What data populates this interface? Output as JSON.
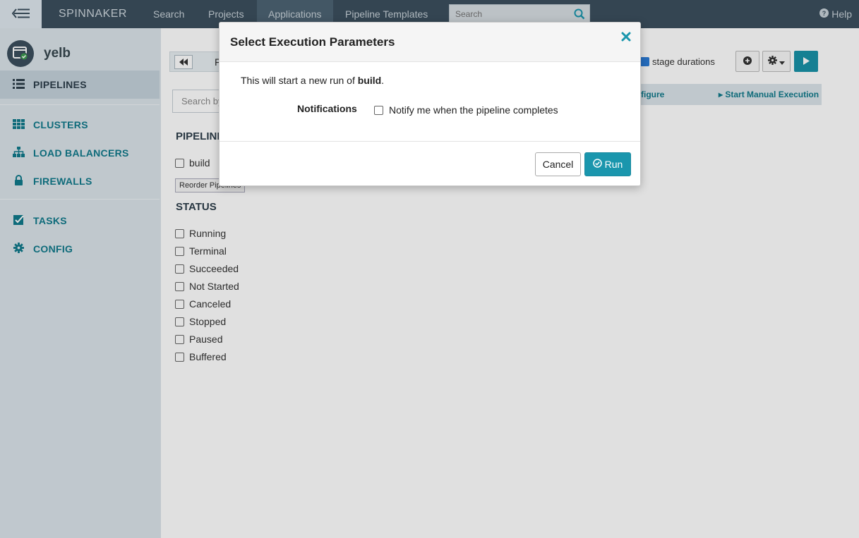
{
  "nav": {
    "brand": "SPINNAKER",
    "links": [
      {
        "label": "Search"
      },
      {
        "label": "Projects"
      },
      {
        "label": "Applications"
      },
      {
        "label": "Pipeline Templates"
      }
    ],
    "search_placeholder": "Search",
    "help_label": "Help"
  },
  "sidebar": {
    "app_name": "yelb",
    "items": [
      {
        "label": "PIPELINES",
        "icon": "list-icon"
      },
      {
        "label": "CLUSTERS",
        "icon": "grid-icon"
      },
      {
        "label": "LOAD BALANCERS",
        "icon": "sitemap-icon"
      },
      {
        "label": "FIREWALLS",
        "icon": "lock-icon"
      },
      {
        "label": "TASKS",
        "icon": "checkbox-icon"
      },
      {
        "label": "CONFIG",
        "icon": "gear-icon"
      }
    ]
  },
  "main": {
    "toolbar_partial": "F",
    "search_placeholder": "Search by",
    "pipelines_title": "PIPELINE",
    "pipelines": [
      {
        "label": "build"
      }
    ],
    "reorder_label": "Reorder Pipelines",
    "status_title": "STATUS",
    "statuses": [
      {
        "label": "Running"
      },
      {
        "label": "Terminal"
      },
      {
        "label": "Succeeded"
      },
      {
        "label": "Not Started"
      },
      {
        "label": "Canceled"
      },
      {
        "label": "Stopped"
      },
      {
        "label": "Paused"
      },
      {
        "label": "Buffered"
      }
    ],
    "stage_durations_label": "stage durations",
    "configure_label": "figure",
    "start_manual_label": "Start Manual Execution"
  },
  "modal": {
    "title": "Select Execution Parameters",
    "message_prefix": "This will start a new run of ",
    "pipeline_name": "build",
    "message_suffix": ".",
    "notifications_label": "Notifications",
    "notify_option": "Notify me when the pipeline completes",
    "cancel_label": "Cancel",
    "run_label": "Run"
  },
  "colors": {
    "accent": "#1a96ad",
    "nav_bg": "#3c4f5e",
    "sidebar_bg": "#dbe4ea",
    "sidebar_text": "#117a8b"
  }
}
